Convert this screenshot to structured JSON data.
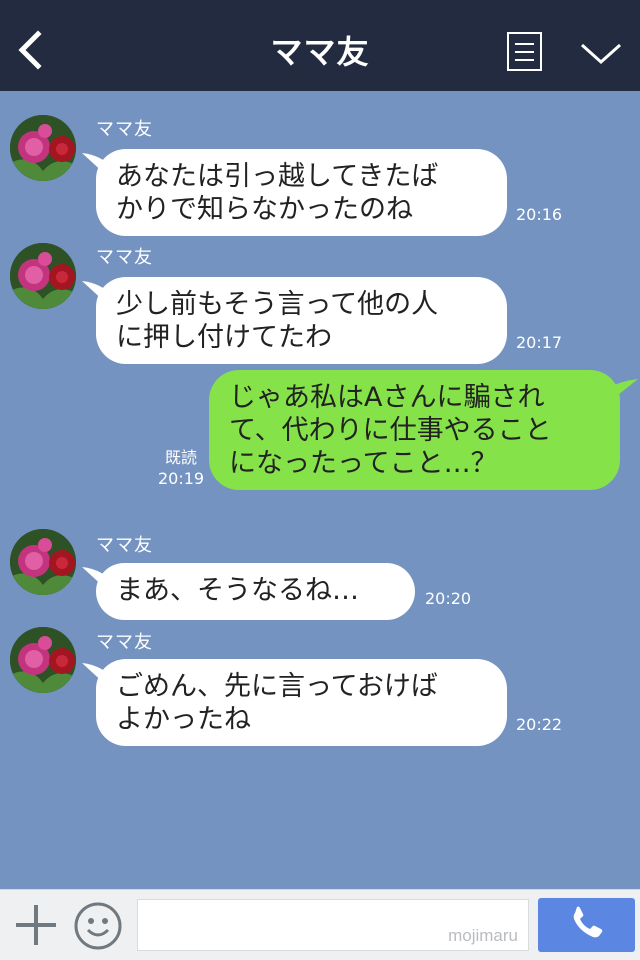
{
  "header": {
    "title": "ママ友",
    "back_icon": "chevron-left-icon",
    "menu_icon": "list-icon",
    "collapse_icon": "chevron-down-icon"
  },
  "messages": [
    {
      "direction": "incoming",
      "sender": "ママ友",
      "text": "あなたは引っ越してきたば\nかりで知らなかったのね",
      "time": "20:16"
    },
    {
      "direction": "incoming",
      "sender": "ママ友",
      "text": "少し前もそう言って他の人\nに押し付けてたわ",
      "time": "20:17"
    },
    {
      "direction": "outgoing",
      "text": "じゃあ私はAさんに騙され\nて、代わりに仕事やること\nになったってこと…？",
      "read_label": "既読",
      "time": "20:19"
    },
    {
      "direction": "incoming",
      "sender": "ママ友",
      "text": "まあ、そうなるね…",
      "time": "20:20"
    },
    {
      "direction": "incoming",
      "sender": "ママ友",
      "text": "ごめん、先に言っておけば\nよかったね",
      "time": "20:22"
    }
  ],
  "footer": {
    "plus_icon": "plus-icon",
    "emoji_icon": "smiley-icon",
    "input_value": "",
    "watermark": "mojimaru",
    "send_icon": "phone-icon"
  },
  "colors": {
    "header_bg": "#222b40",
    "chat_bg": "#7493c1",
    "incoming_bubble": "#ffffff",
    "outgoing_bubble": "#85e249",
    "send_button": "#5b86e2"
  }
}
